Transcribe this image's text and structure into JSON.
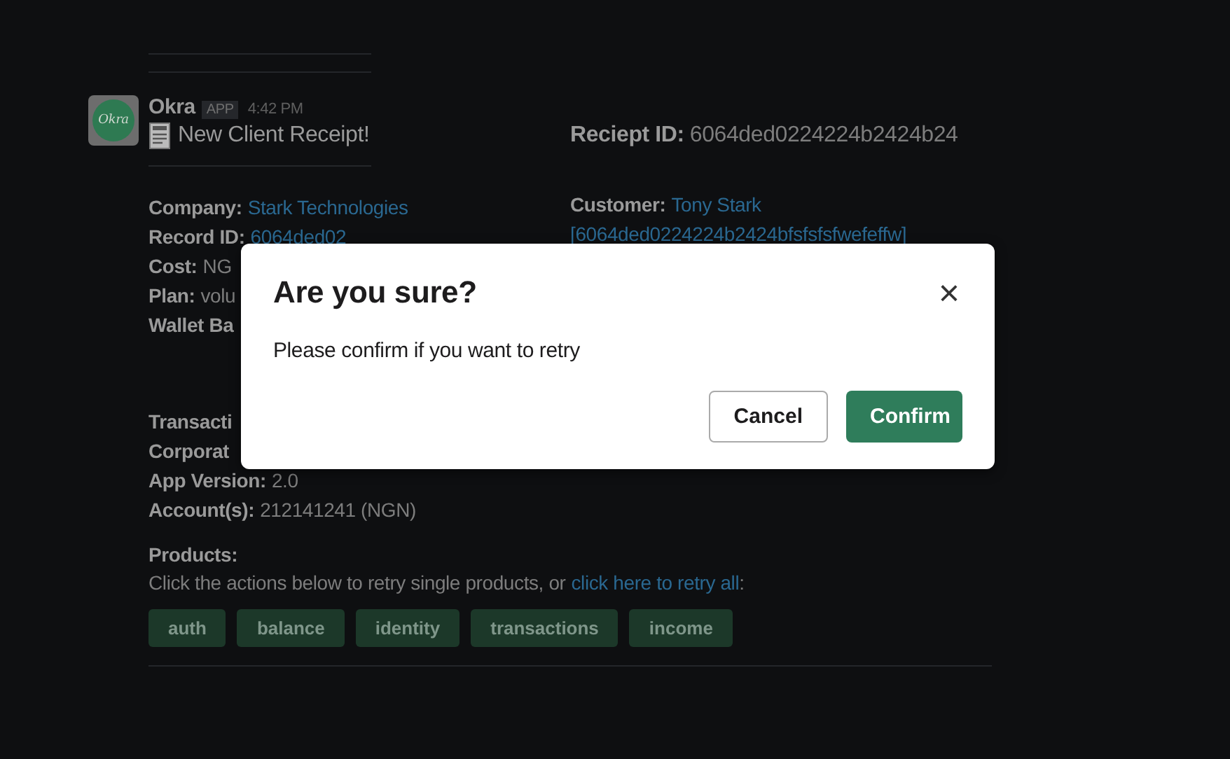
{
  "message": {
    "avatar_text": "Okra",
    "sender": "Okra",
    "badge": "APP",
    "time": "4:42 PM",
    "title": "New Client Receipt!",
    "receipt": {
      "label": "Reciept ID:",
      "value": "6064ded0224224b2424b24"
    }
  },
  "left_fields": [
    {
      "label": "Company:",
      "value": "Stark Technologies",
      "link": true
    },
    {
      "label": "Record ID:",
      "value": "6064ded02",
      "link": true
    },
    {
      "label": "Cost:",
      "value": "NG",
      "link": false
    },
    {
      "label": "Plan:",
      "value": "volu",
      "link": false
    },
    {
      "label": "Wallet Ba"
    }
  ],
  "customer": {
    "label": "Customer:",
    "value": "Tony Stark",
    "id": "[6064ded0224224b2424bfsfsfsfwefeffw]"
  },
  "left_fields_2": [
    {
      "label": "Transacti"
    },
    {
      "label": "Corporat"
    },
    {
      "label": "App Version:",
      "value": "2.0",
      "link": false
    },
    {
      "label": "Account(s):",
      "value": "212141241 (NGN)",
      "link": false
    }
  ],
  "products": {
    "label": "Products:",
    "hint": "Click the actions below to retry single products, or",
    "link": "click here to retry all",
    "hint_end": ":",
    "items": [
      "auth",
      "balance",
      "identity",
      "transactions",
      "income"
    ]
  },
  "dialog": {
    "title": "Are you sure?",
    "close": "×",
    "message": "Please confirm if you want to retry",
    "buttons": [
      {
        "label": "Cancel",
        "kind": "secondary"
      },
      {
        "label": "Confirm",
        "kind": "primary"
      }
    ]
  }
}
